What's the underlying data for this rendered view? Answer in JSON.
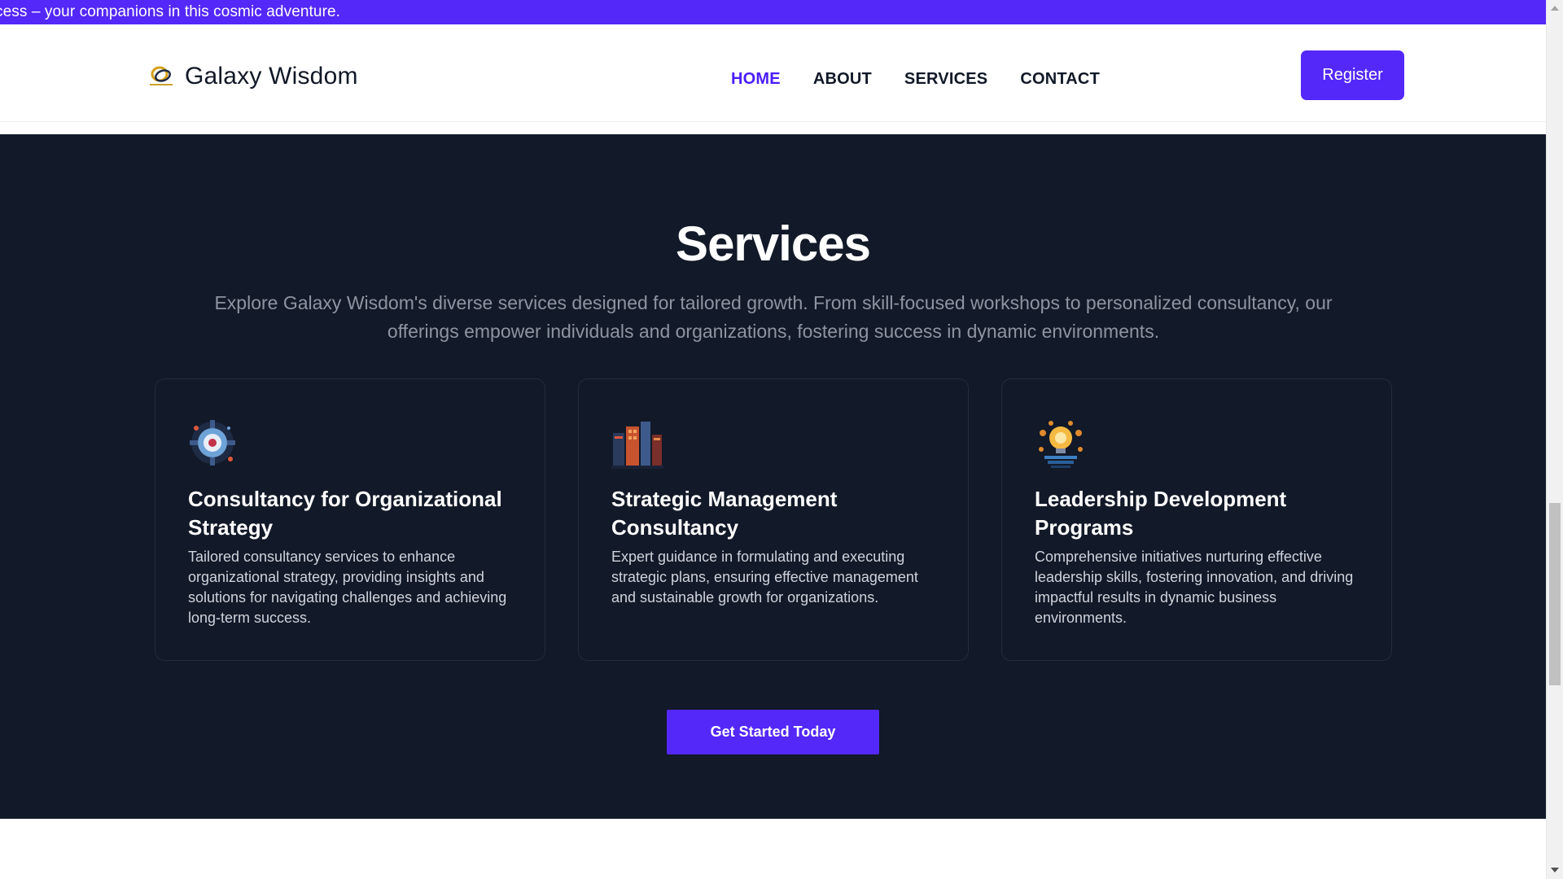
{
  "announcement": {
    "text": "cess – your companions in this cosmic adventure."
  },
  "header": {
    "brand_name": "Galaxy Wisdom",
    "logo_icon": "galaxy-wisdom-logo",
    "nav": [
      {
        "label": "HOME",
        "active": true
      },
      {
        "label": "ABOUT",
        "active": false
      },
      {
        "label": "SERVICES",
        "active": false
      },
      {
        "label": "CONTACT",
        "active": false
      }
    ],
    "register_label": "Register"
  },
  "services": {
    "title": "Services",
    "description": "Explore Galaxy Wisdom's diverse services designed for tailored growth. From skill-focused workshops to personalized consultancy, our offerings empower individuals and organizations, fostering success in dynamic environments.",
    "cards": [
      {
        "icon": "strategy-gear-icon",
        "title": "Consultancy for Organizational Strategy",
        "text": "Tailored consultancy services to enhance organizational strategy, providing insights and solutions for navigating challenges and achieving long-term success."
      },
      {
        "icon": "management-buildings-icon",
        "title": "Strategic Management Consultancy",
        "text": "Expert guidance in formulating and executing strategic plans, ensuring effective management and sustainable growth for organizations."
      },
      {
        "icon": "leadership-lightbulb-icon",
        "title": "Leadership Development Programs",
        "text": "Comprehensive initiatives nurturing effective leadership skills, fostering innovation, and driving impactful results in dynamic business environments."
      }
    ],
    "cta_label": "Get Started Today"
  },
  "colors": {
    "accent": "#5328f8",
    "nav_active": "#4c1dfa",
    "section_bg": "#121928"
  }
}
